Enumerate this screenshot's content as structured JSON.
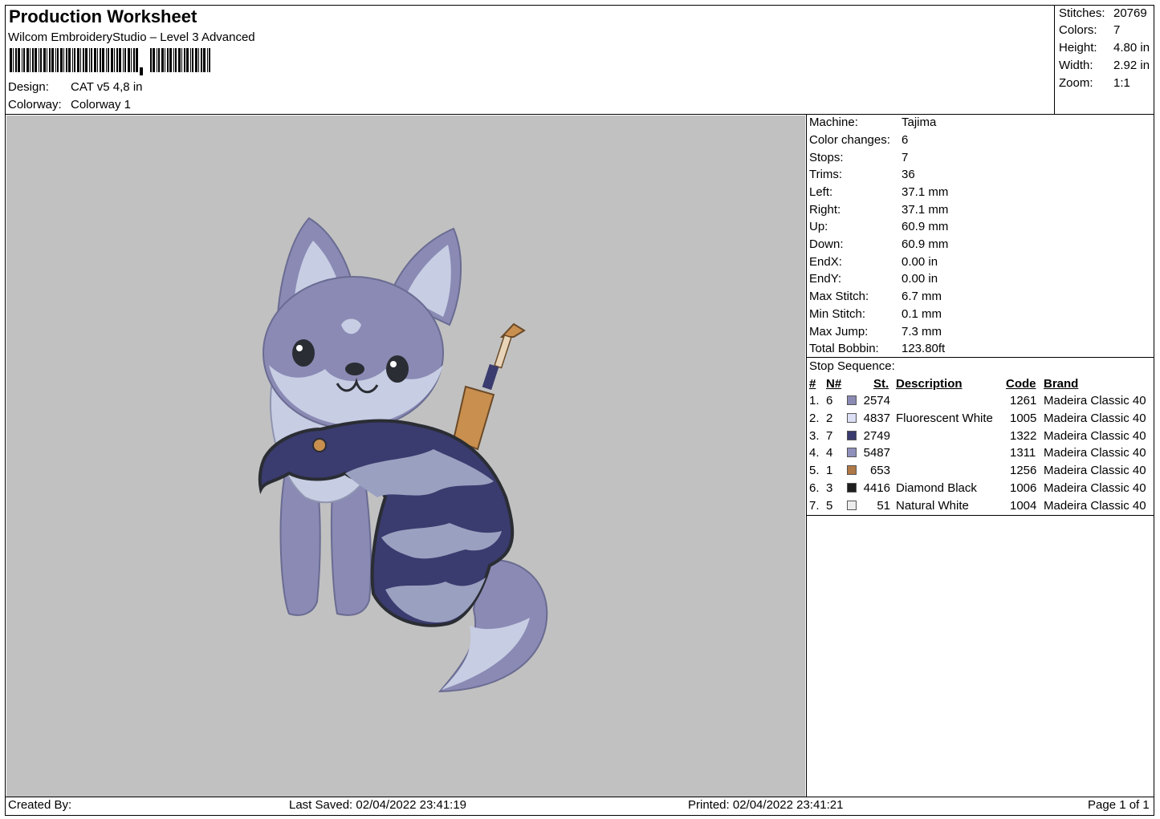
{
  "header": {
    "title": "Production Worksheet",
    "software": "Wilcom EmbroideryStudio – Level 3 Advanced",
    "design_label": "Design:",
    "design_value": "CAT v5 4,8 in",
    "colorway_label": "Colorway:",
    "colorway_value": "Colorway 1"
  },
  "summary": [
    {
      "label": "Stitches:",
      "value": "20769"
    },
    {
      "label": "Colors:",
      "value": "7"
    },
    {
      "label": "Height:",
      "value": "4.80 in"
    },
    {
      "label": "Width:",
      "value": "2.92 in"
    },
    {
      "label": "Zoom:",
      "value": "1:1"
    }
  ],
  "machine_info": [
    {
      "label": "Machine:",
      "value": "Tajima"
    },
    {
      "label": "Color changes:",
      "value": "6"
    },
    {
      "label": "Stops:",
      "value": "7"
    },
    {
      "label": "Trims:",
      "value": "36"
    },
    {
      "label": "Left:",
      "value": "37.1 mm"
    },
    {
      "label": "Right:",
      "value": "37.1 mm"
    },
    {
      "label": "Up:",
      "value": "60.9 mm"
    },
    {
      "label": "Down:",
      "value": "60.9 mm"
    },
    {
      "label": "EndX:",
      "value": "0.00 in"
    },
    {
      "label": "EndY:",
      "value": "0.00 in"
    },
    {
      "label": "Max Stitch:",
      "value": "6.7 mm"
    },
    {
      "label": "Min Stitch:",
      "value": "0.1 mm"
    },
    {
      "label": "Max Jump:",
      "value": "7.3 mm"
    },
    {
      "label": "Total Bobbin:",
      "value": "123.80ft"
    }
  ],
  "stop_sequence": {
    "title": "Stop Sequence:",
    "headers": {
      "num": "#",
      "n": "N#",
      "st": "St.",
      "desc": "Description",
      "code": "Code",
      "brand": "Brand"
    },
    "rows": [
      {
        "num": "1.",
        "n": "6",
        "color": "#8a8ab4",
        "st": "2574",
        "desc": "",
        "code": "1261",
        "brand": "Madeira Classic 40"
      },
      {
        "num": "2.",
        "n": "2",
        "color": "#dde0f5",
        "st": "4837",
        "desc": "Fluorescent White",
        "code": "1005",
        "brand": "Madeira Classic 40"
      },
      {
        "num": "3.",
        "n": "7",
        "color": "#3a3b6e",
        "st": "2749",
        "desc": "",
        "code": "1322",
        "brand": "Madeira Classic 40"
      },
      {
        "num": "4.",
        "n": "4",
        "color": "#9090bc",
        "st": "5487",
        "desc": "",
        "code": "1311",
        "brand": "Madeira Classic 40"
      },
      {
        "num": "5.",
        "n": "1",
        "color": "#b07846",
        "st": "653",
        "desc": "",
        "code": "1256",
        "brand": "Madeira Classic 40"
      },
      {
        "num": "6.",
        "n": "3",
        "color": "#1e1e1e",
        "st": "4416",
        "desc": "Diamond Black",
        "code": "1006",
        "brand": "Madeira Classic 40"
      },
      {
        "num": "7.",
        "n": "5",
        "color": "#ececec",
        "st": "51",
        "desc": "Natural White",
        "code": "1004",
        "brand": "Madeira Classic 40"
      }
    ]
  },
  "footer": {
    "created_by": "Created By:",
    "last_saved": "Last Saved: 02/04/2022 23:41:19",
    "printed": "Printed: 02/04/2022 23:41:21",
    "page": "Page 1 of 1"
  },
  "colors": {
    "preview_bg": "#c1c1c1",
    "fur_main": "#8a8ab4",
    "fur_light": "#c7cde3",
    "cape": "#3a3b6e",
    "cape_wave": "#9aa0c0",
    "outline": "#2a2d33",
    "sword": "#c98f4f"
  }
}
